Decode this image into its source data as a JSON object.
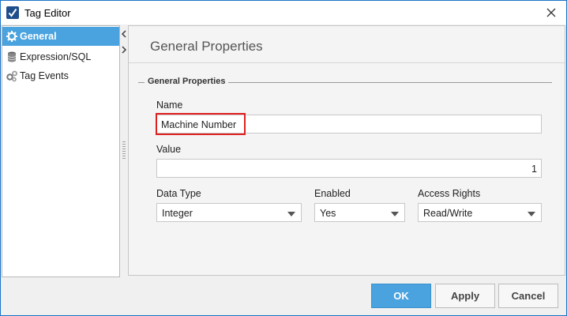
{
  "window": {
    "title": "Tag Editor"
  },
  "sidebar": {
    "items": [
      {
        "label": "General",
        "icon": "gear-icon",
        "active": true
      },
      {
        "label": "Expression/SQL",
        "icon": "database-icon",
        "active": false
      },
      {
        "label": "Tag Events",
        "icon": "gears-icon",
        "active": false
      }
    ]
  },
  "panel": {
    "title": "General Properties",
    "group_title": "General Properties",
    "fields": {
      "name_label": "Name",
      "name_value": "Machine Number",
      "value_label": "Value",
      "value_value": "1",
      "data_type_label": "Data Type",
      "data_type_value": "Integer",
      "enabled_label": "Enabled",
      "enabled_value": "Yes",
      "access_rights_label": "Access Rights",
      "access_rights_value": "Read/Write"
    }
  },
  "buttons": {
    "ok": "OK",
    "apply": "Apply",
    "cancel": "Cancel"
  },
  "colors": {
    "accent": "#4aa3df",
    "highlight": "#e02020"
  }
}
